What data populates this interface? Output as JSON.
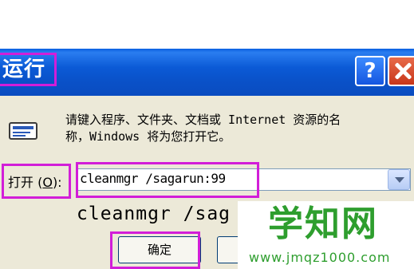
{
  "window": {
    "title": "运行",
    "help_label": "?",
    "close_label": "close"
  },
  "dialog": {
    "description_line1": "请键入程序、文件夹、文档或 Internet 资源的名",
    "description_line2": "称，Windows 将为您打开它。",
    "open_label_prefix": "打开 (",
    "open_label_key": "O",
    "open_label_suffix": "):",
    "command_value": "cleanmgr /sagarun:99",
    "enlarged_command": "cleanmgr /sag",
    "ok_label": "确定",
    "cancel_label": ""
  },
  "watermark": {
    "brand": "学知网",
    "url": "www.jmqz1000.com"
  },
  "colors": {
    "titlebar": "#0a51c8",
    "highlight": "#d21ed8",
    "dialog_bg": "#ece9d8",
    "watermark": "#2e9e2e"
  },
  "icons": {
    "run": "run-icon",
    "help": "help-icon",
    "close": "close-icon",
    "dropdown": "chevron-down-icon"
  }
}
